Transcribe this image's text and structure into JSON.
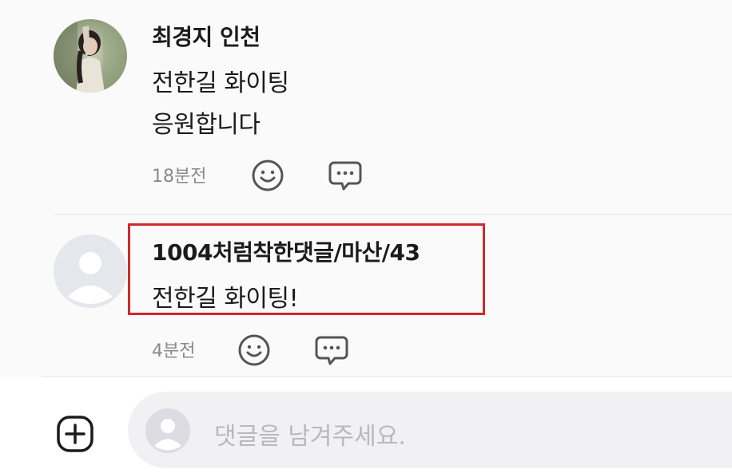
{
  "comments": [
    {
      "author": "최경지 인천",
      "lines": [
        "전한길  화이팅",
        "응원합니다"
      ],
      "time": "18분전"
    },
    {
      "author": "1004처럼착한댓글/마산/43",
      "lines": [
        "전한길 화이팅!"
      ],
      "time": "4분전"
    }
  ],
  "composer": {
    "placeholder": "댓글을 남겨주세요."
  },
  "colors": {
    "highlight": "#d0282e",
    "icon_gray": "#555555",
    "placeholder": "#b9b9bd"
  },
  "icons": {
    "reaction": "smiley-icon",
    "reply": "speech-bubble-icon",
    "attach": "plus-square-icon",
    "avatar_default": "user-silhouette-icon"
  }
}
